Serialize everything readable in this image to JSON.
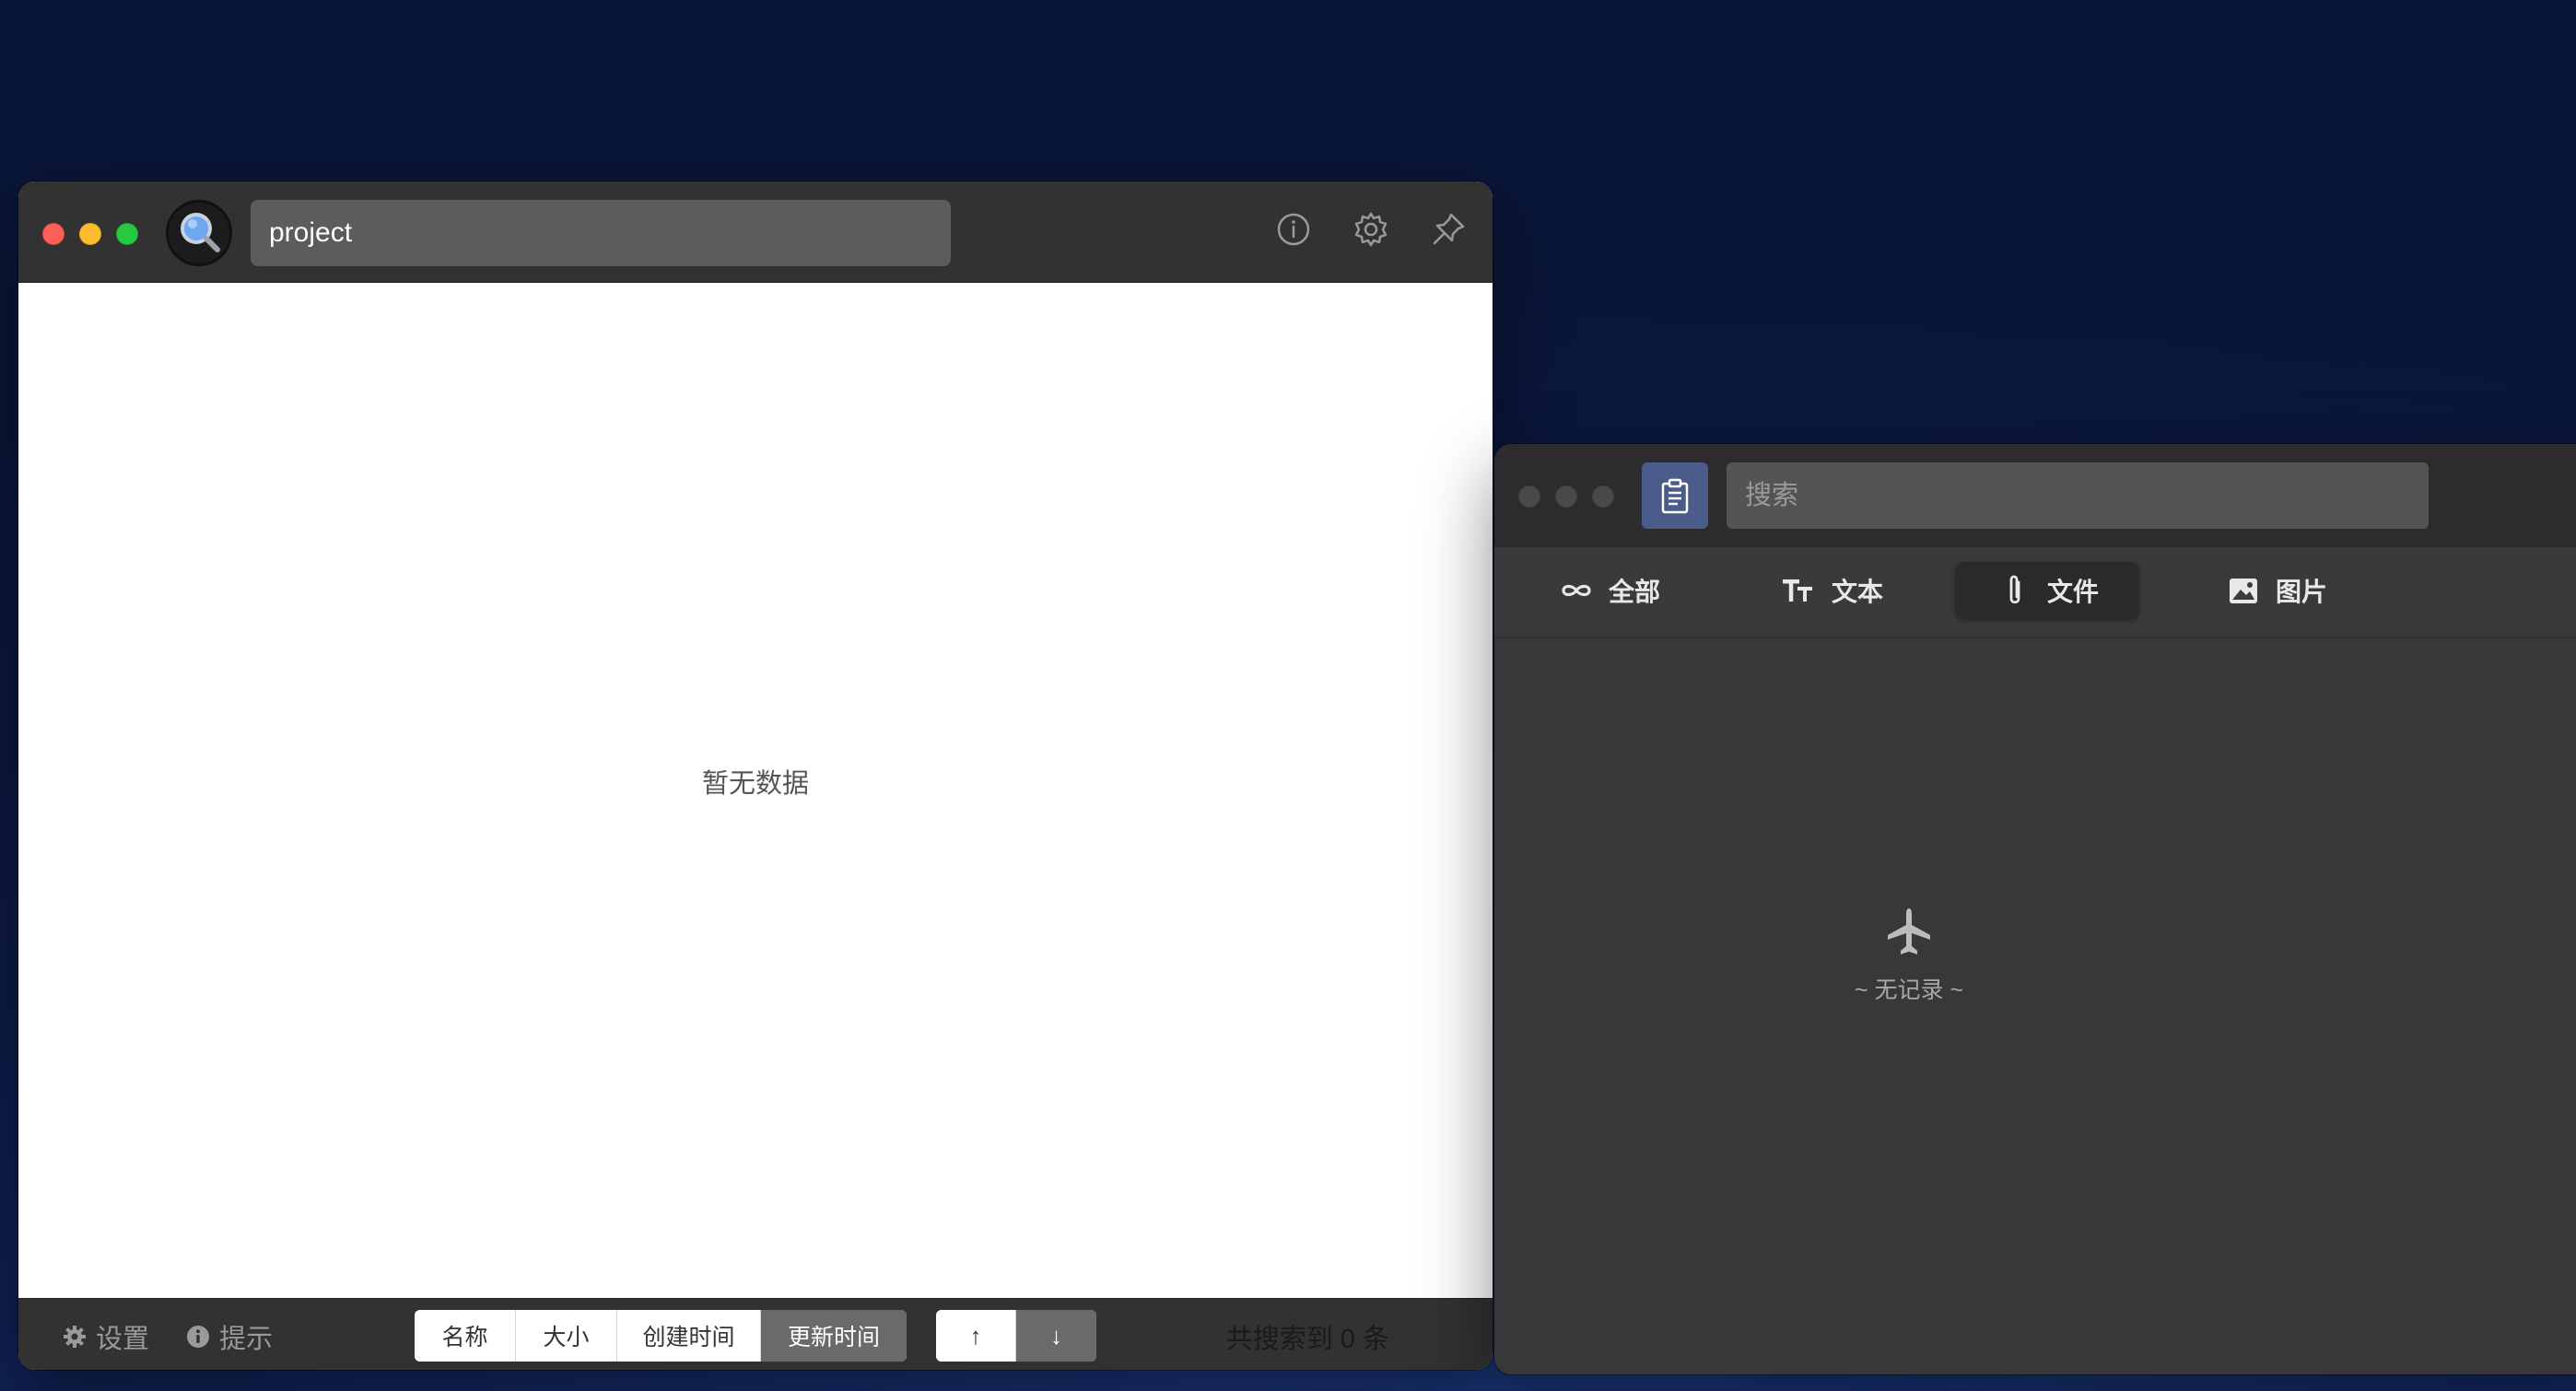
{
  "search_window": {
    "search": {
      "value": "project"
    },
    "empty_message": "暂无数据",
    "footer": {
      "settings_label": "设置",
      "tips_label": "提示",
      "sort_options": [
        "名称",
        "大小",
        "创建时间",
        "更新时间"
      ],
      "active_sort": "更新时间",
      "asc_label": "↑",
      "desc_label": "↓",
      "result_count_text": "共搜索到 0 条"
    }
  },
  "clipboard_window": {
    "search": {
      "placeholder": "搜索"
    },
    "tabs": [
      {
        "label": "全部",
        "icon": "infinity-icon"
      },
      {
        "label": "文本",
        "icon": "text-format-icon"
      },
      {
        "label": "文件",
        "icon": "paperclip-icon",
        "active": true
      },
      {
        "label": "图片",
        "icon": "image-icon"
      }
    ],
    "empty_message": "~ 无记录 ~"
  },
  "colors": {
    "desktop_bg": "#0d1b47",
    "titlebar_dark": "#323233",
    "active_segment": "#6a6a6c",
    "clip_logo_bg": "#4b5b8a"
  }
}
